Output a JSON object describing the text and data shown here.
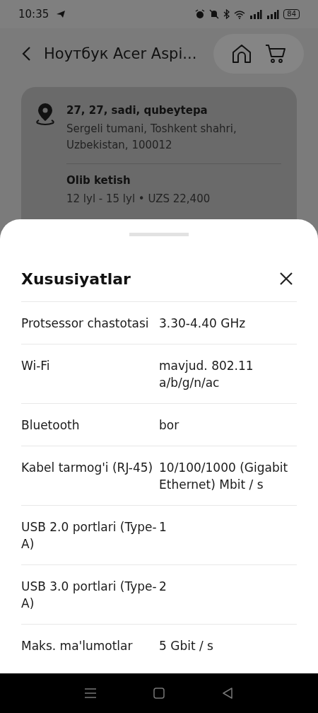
{
  "status_bar": {
    "time": "10:35",
    "battery": "84"
  },
  "header": {
    "title": "Ноутбук Acer Aspi..."
  },
  "address": {
    "title": "27, 27, sadi, qubeytepa",
    "detail": "Sergeli tumani, Toshkent shahri, Uzbekistan, 100012",
    "delivery_title": "Olib ketish",
    "delivery_info": "12 lyl - 15 lyl • UZS 22,400"
  },
  "sheet": {
    "title": "Xususiyatlar",
    "rows": [
      {
        "label": "Protsessor chastotasi",
        "value": "3.30-4.40 GHz"
      },
      {
        "label": "Wi-Fi",
        "value": "mavjud. 802.11 a/b/g/n/ac"
      },
      {
        "label": "Bluetooth",
        "value": "bor"
      },
      {
        "label": "Kabel tarmog'i (RJ-45)",
        "value": "10/100/1000 (Gigabit Ethernet) Mbit / s"
      },
      {
        "label": "USB 2.0 portlari (Type-A)",
        "value": "1"
      },
      {
        "label": "USB 3.0 portlari (Type-A)",
        "value": "2"
      },
      {
        "label": "Maks. ma'lumotlar",
        "value": "5 Gbit / s"
      }
    ]
  }
}
